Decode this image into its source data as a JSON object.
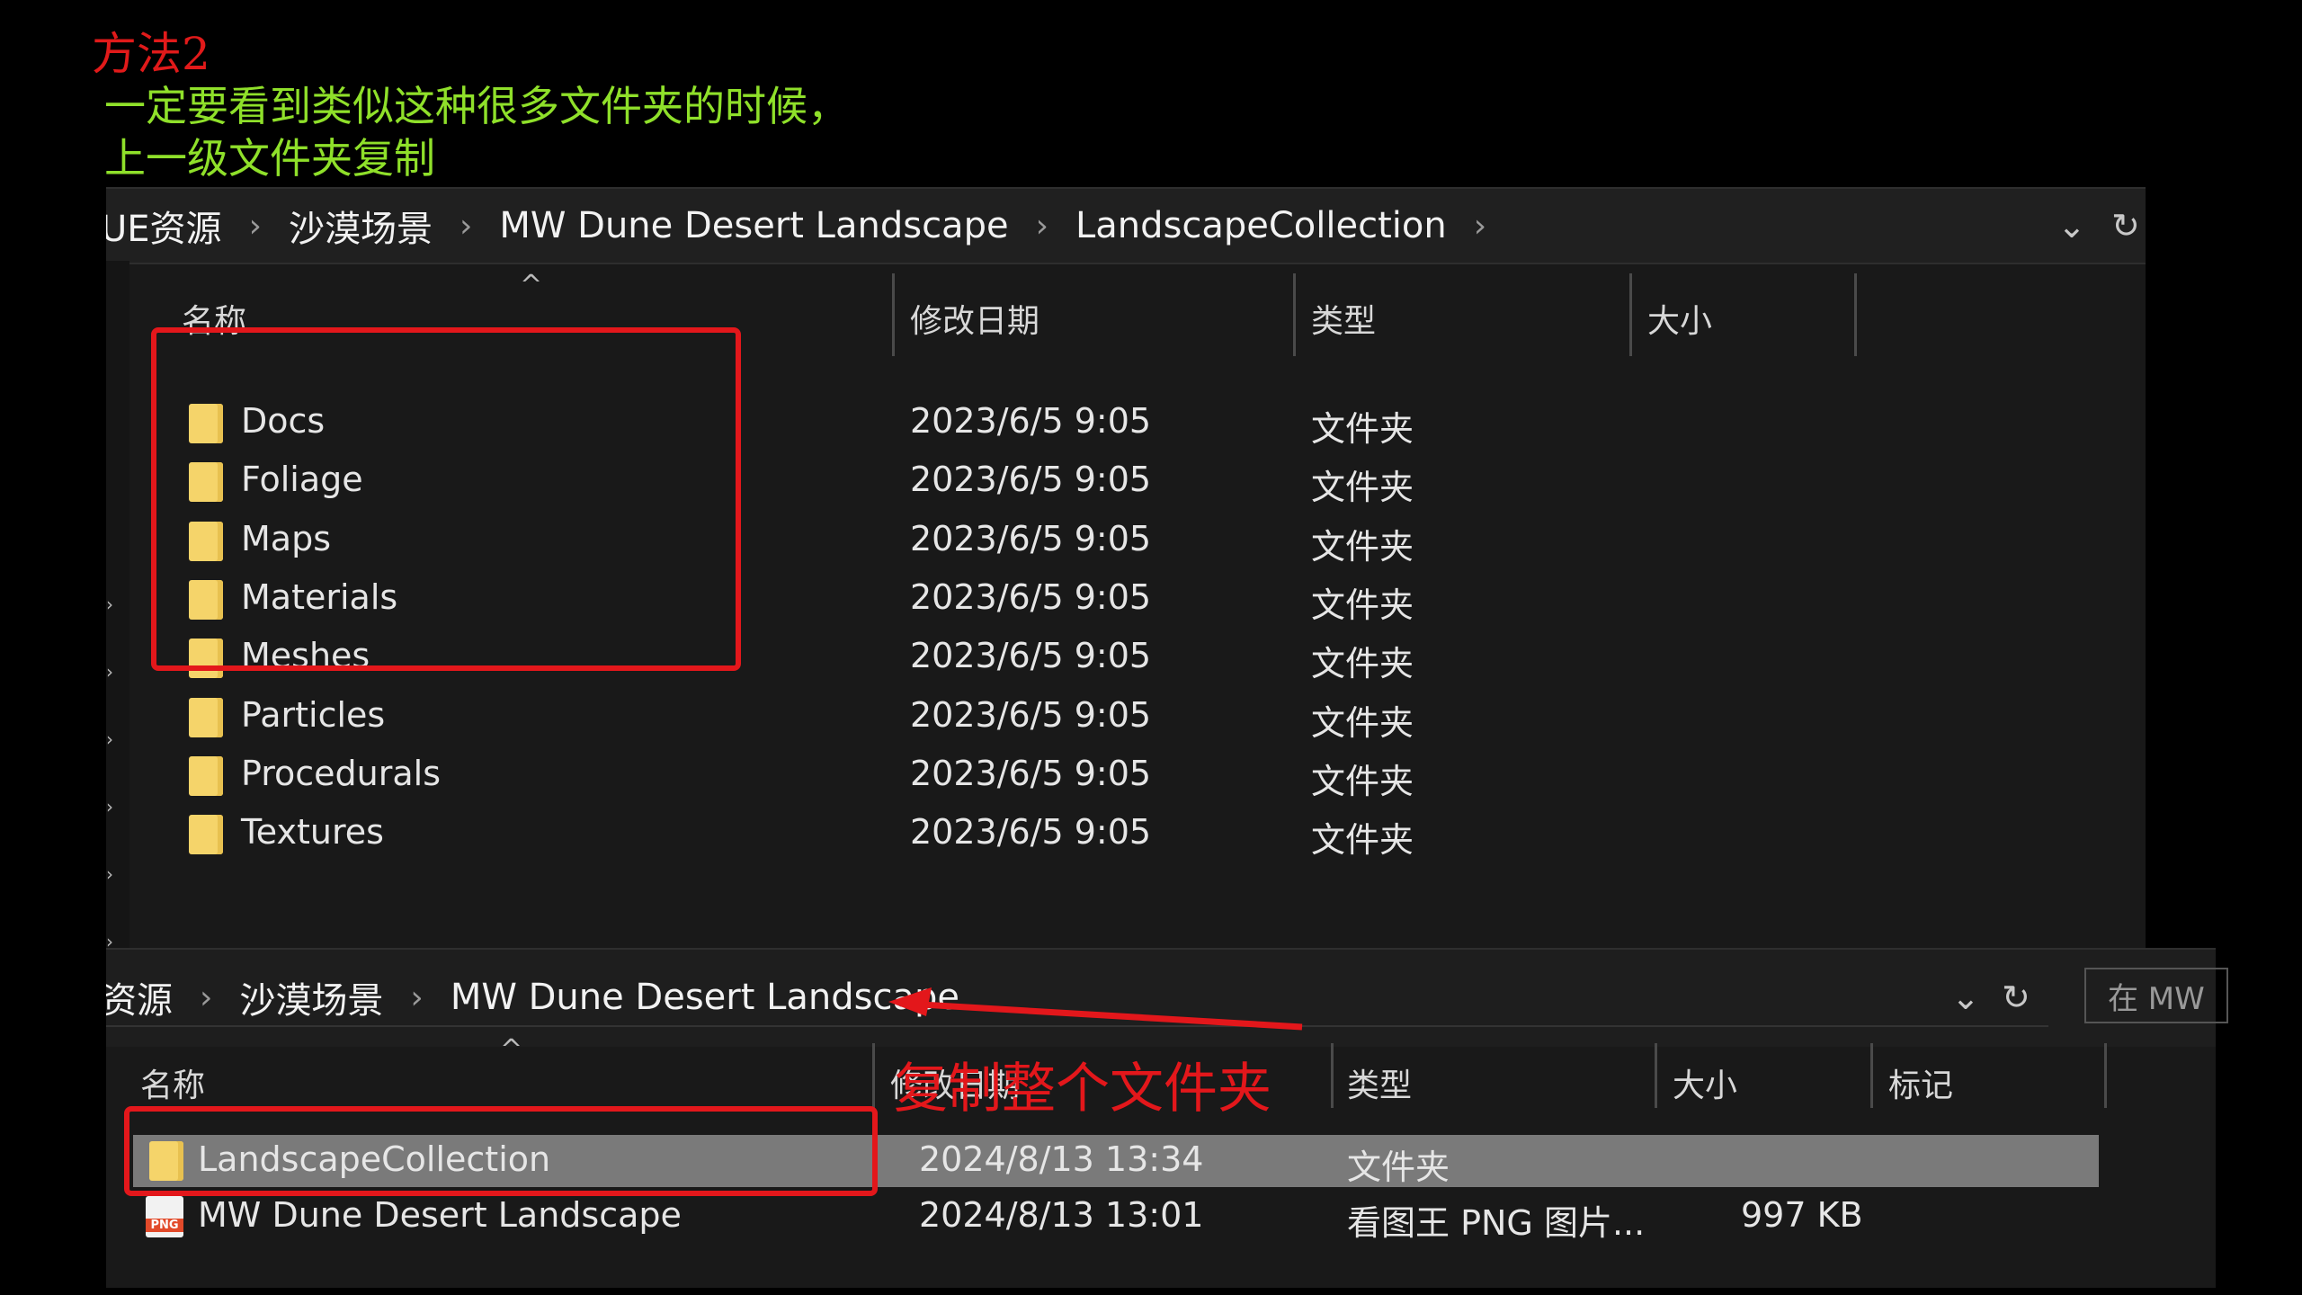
{
  "caption": {
    "title": "方法2",
    "line1": "一定要看到类似这种很多文件夹的时候，",
    "line2": "上一级文件夹复制"
  },
  "window1": {
    "breadcrumbs": [
      "UE资源",
      "沙漠场景",
      "MW Dune Desert Landscape",
      "LandscapeCollection"
    ],
    "columns": {
      "name": "名称",
      "date": "修改日期",
      "type": "类型",
      "size": "大小"
    },
    "rows": [
      {
        "name": "Docs",
        "date": "2023/6/5 9:05",
        "type": "文件夹"
      },
      {
        "name": "Foliage",
        "date": "2023/6/5 9:05",
        "type": "文件夹"
      },
      {
        "name": "Maps",
        "date": "2023/6/5 9:05",
        "type": "文件夹"
      },
      {
        "name": "Materials",
        "date": "2023/6/5 9:05",
        "type": "文件夹"
      },
      {
        "name": "Meshes",
        "date": "2023/6/5 9:05",
        "type": "文件夹"
      },
      {
        "name": "Particles",
        "date": "2023/6/5 9:05",
        "type": "文件夹"
      },
      {
        "name": "Procedurals",
        "date": "2023/6/5 9:05",
        "type": "文件夹"
      },
      {
        "name": "Textures",
        "date": "2023/6/5 9:05",
        "type": "文件夹"
      }
    ],
    "icons": {
      "dropdown": "chevron-down-icon",
      "refresh": "refresh-icon",
      "sort": "sort-up-icon"
    }
  },
  "window2": {
    "breadcrumbs": [
      "资源",
      "沙漠场景",
      "MW Dune Desert Landscape"
    ],
    "search_placeholder": "在 MW",
    "columns": {
      "name": "名称",
      "date": "修改日期",
      "type": "类型",
      "size": "大小",
      "tag": "标记"
    },
    "rows": [
      {
        "name": "LandscapeCollection",
        "date": "2024/8/13 13:34",
        "type": "文件夹",
        "size": "",
        "icon": "folder-icon",
        "selected": true
      },
      {
        "name": "MW Dune Desert Landscape",
        "date": "2024/8/13 13:01",
        "type": "看图王 PNG 图片...",
        "size": "997 KB",
        "icon": "png-file-icon",
        "selected": false
      }
    ],
    "annotation": "复制整个文件夹",
    "png_badge": "PNG"
  },
  "colors": {
    "caption_title": "#e11a1a",
    "caption_text": "#8fe02a",
    "highlight_box": "#e3171b",
    "folder": "#f5d46a",
    "selected_row": "#7a7a7a"
  }
}
